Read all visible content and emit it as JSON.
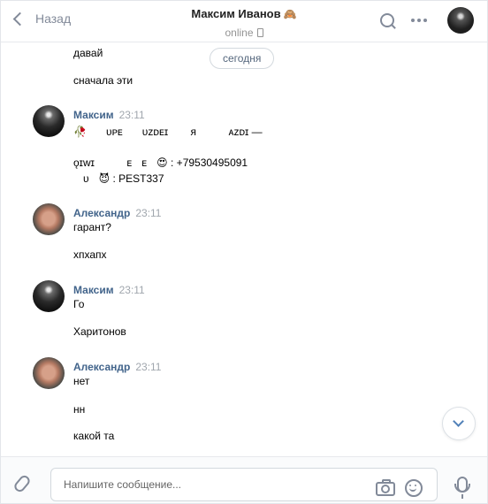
{
  "header": {
    "back_label": "Назад",
    "contact_name": "Максим Иванов",
    "contact_emoji": "🙈",
    "status": "online",
    "icons": [
      "chevron-left-icon",
      "search-icon",
      "more-icon",
      "phone-icon"
    ]
  },
  "chat": {
    "date_chip": "сегодня",
    "lines": [
      "давай",
      "сначала эти",
      "🥀ᅠᅠᴜᴘᴇᅠᅠᴜᴢᴅᴇɪ ᅠᅠᴙ ᅠᅠᅠᴀᴢᴅɪ —",
      "ǫɪᴡɪ ᅠᅠᅠᴇᅠᴇᅠ😍 : +79530495091",
      "ᅠᴜᅠ😈 : PEST337",
      "гарант?",
      "хпхапх",
      "Го",
      "Харитонов",
      "нет",
      "нн",
      "какой та"
    ],
    "messages": [
      {
        "author": "Максим",
        "time": "23:11"
      },
      {
        "author": "Александр",
        "time": "23:11"
      },
      {
        "author": "Максим",
        "time": "23:11"
      },
      {
        "author": "Александр",
        "time": "23:11"
      }
    ]
  },
  "composer": {
    "placeholder": "Напишите сообщение..."
  },
  "colors": {
    "accent": "#42648b",
    "muted": "#828a99",
    "time": "#a0a6ad",
    "border": "#e7e8ec"
  }
}
